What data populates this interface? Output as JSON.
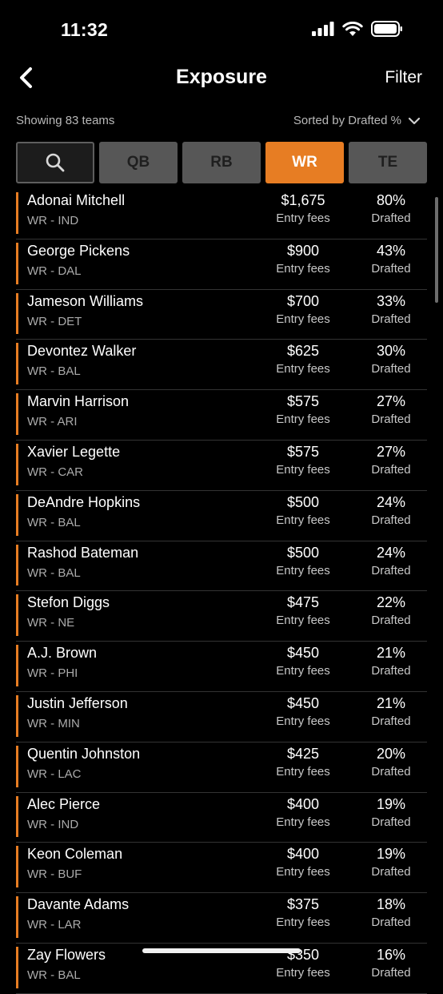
{
  "status": {
    "time": "11:32"
  },
  "nav": {
    "title": "Exposure",
    "filter_label": "Filter"
  },
  "meta": {
    "count_text": "Showing 83 teams",
    "sort_text": "Sorted by Drafted %"
  },
  "tabs": [
    {
      "label": "QB",
      "active": false
    },
    {
      "label": "RB",
      "active": false
    },
    {
      "label": "WR",
      "active": true
    },
    {
      "label": "TE",
      "active": false
    }
  ],
  "colors": {
    "accent": "#e77d23",
    "background": "#000000",
    "tab_inactive": "#575757"
  },
  "labels": {
    "fee": "Entry fees",
    "pct": "Drafted"
  },
  "players": [
    {
      "name": "Adonai Mitchell",
      "pos": "WR - IND",
      "fee": "$1,675",
      "pct": "80%"
    },
    {
      "name": "George Pickens",
      "pos": "WR - DAL",
      "fee": "$900",
      "pct": "43%"
    },
    {
      "name": "Jameson Williams",
      "pos": "WR - DET",
      "fee": "$700",
      "pct": "33%"
    },
    {
      "name": "Devontez Walker",
      "pos": "WR - BAL",
      "fee": "$625",
      "pct": "30%"
    },
    {
      "name": "Marvin Harrison",
      "pos": "WR - ARI",
      "fee": "$575",
      "pct": "27%"
    },
    {
      "name": "Xavier Legette",
      "pos": "WR - CAR",
      "fee": "$575",
      "pct": "27%"
    },
    {
      "name": "DeAndre Hopkins",
      "pos": "WR - BAL",
      "fee": "$500",
      "pct": "24%"
    },
    {
      "name": "Rashod Bateman",
      "pos": "WR - BAL",
      "fee": "$500",
      "pct": "24%"
    },
    {
      "name": "Stefon Diggs",
      "pos": "WR - NE",
      "fee": "$475",
      "pct": "22%"
    },
    {
      "name": "A.J. Brown",
      "pos": "WR - PHI",
      "fee": "$450",
      "pct": "21%"
    },
    {
      "name": "Justin Jefferson",
      "pos": "WR - MIN",
      "fee": "$450",
      "pct": "21%"
    },
    {
      "name": "Quentin Johnston",
      "pos": "WR - LAC",
      "fee": "$425",
      "pct": "20%"
    },
    {
      "name": "Alec Pierce",
      "pos": "WR - IND",
      "fee": "$400",
      "pct": "19%"
    },
    {
      "name": "Keon Coleman",
      "pos": "WR - BUF",
      "fee": "$400",
      "pct": "19%"
    },
    {
      "name": "Davante Adams",
      "pos": "WR - LAR",
      "fee": "$375",
      "pct": "18%"
    },
    {
      "name": "Zay Flowers",
      "pos": "WR - BAL",
      "fee": "$350",
      "pct": "16%"
    }
  ]
}
